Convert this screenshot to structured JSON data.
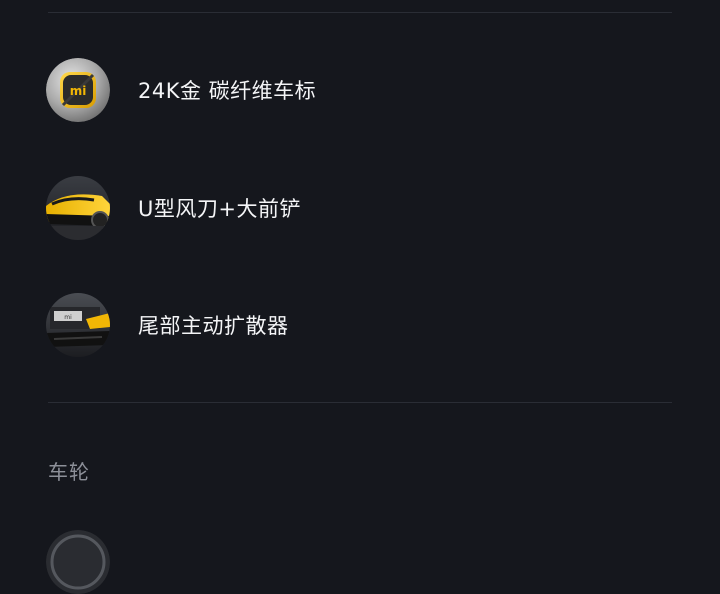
{
  "features": [
    {
      "label": "24K金 碳纤维车标",
      "icon": "xiaomi-badge-icon"
    },
    {
      "label": "U型风刀+大前铲",
      "icon": "car-front-icon"
    },
    {
      "label": "尾部主动扩散器",
      "icon": "rear-diffuser-icon"
    }
  ],
  "badge_text": "mi",
  "rear_plate_text": "mi",
  "next_section": {
    "title": "车轮"
  },
  "colors": {
    "background": "#15171d",
    "divider": "#2a2d35",
    "accent_yellow": "#f2b705",
    "section_title": "#8d9099"
  }
}
